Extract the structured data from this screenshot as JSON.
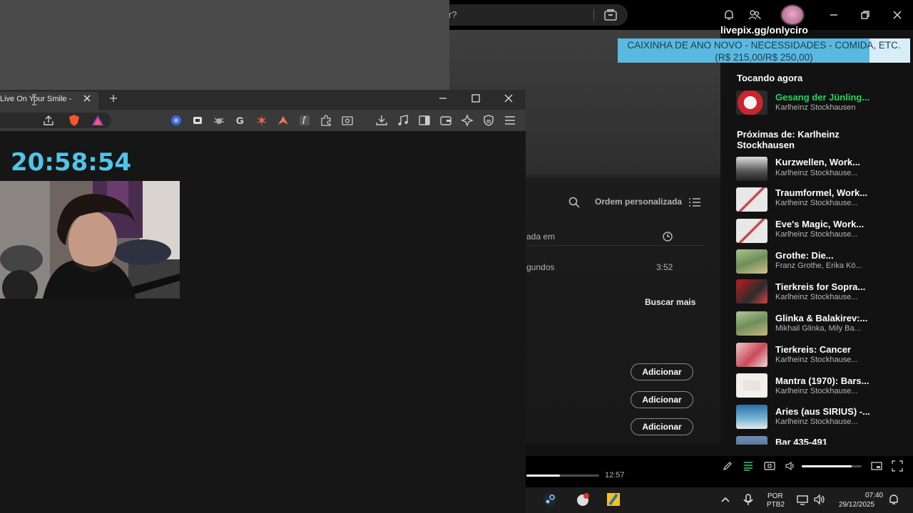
{
  "spotify": {
    "search_text": "ir?",
    "order_label": "Ordem personalizada",
    "col_added": "ada em",
    "row_added": "gundos",
    "row_duration": "3:52",
    "search_more": "Buscar mais",
    "add_labels": [
      "Adicionar",
      "Adicionar",
      "Adicionar"
    ],
    "queue": {
      "now_playing_title": "Tocando agora",
      "current": {
        "title": "Gesang der Jünling...",
        "artist": "Karlheinz Stockhausen"
      },
      "next_title": "Próximas de: Karlheinz Stockhausen",
      "items": [
        {
          "title": "Kurzwellen, Work...",
          "artist": "Karlheinz Stockhause..."
        },
        {
          "title": "Traumformel, Work...",
          "artist": "Karlheinz Stockhause..."
        },
        {
          "title": "Eve's Magic, Work...",
          "artist": "Karlheinz Stockhause..."
        },
        {
          "title": "Grothe: Die...",
          "artist": "Franz Grothe, Erika Kö..."
        },
        {
          "title": "Tierkreis for Sopra...",
          "artist": "Karlheinz Stockhause..."
        },
        {
          "title": "Glinka & Balakirev:...",
          "artist": "Mikhail Glinka, Mily Ba..."
        },
        {
          "title": "Tierkreis: Cancer",
          "artist": "Karlheinz Stockhause..."
        },
        {
          "title": "Mantra (1970): Bars...",
          "artist": "Karlheinz Stockhause..."
        },
        {
          "title": "Aries (aus SIRIUS) -...",
          "artist": "Karlheinz Stockhause..."
        },
        {
          "title": "Bar 435-491",
          "artist": ""
        }
      ]
    },
    "player": {
      "total_time": "12:57",
      "progress_fraction": 0.46,
      "volume_fraction": 0.83
    }
  },
  "browser": {
    "tab_title": "Live On Your Smile -"
  },
  "overlay": {
    "clock": "20:58:54",
    "livepix": "livepix.gg/onlyciro",
    "donation_line1": "CAIXINHA DE ANO NOVO - NECESSIDADES - COMIDA, ETC.",
    "donation_line2": "(R$ 215,00/R$ 250,00)",
    "donation_progress_fraction": 0.86
  },
  "taskbar": {
    "lang1": "POR",
    "lang2": "PTB2",
    "time": "07:40",
    "date": "29/12/2025"
  },
  "colors": {
    "accent_green": "#1ed760",
    "clock_cyan": "#4fc4e8",
    "donation_bar": "#5ab9e0"
  }
}
